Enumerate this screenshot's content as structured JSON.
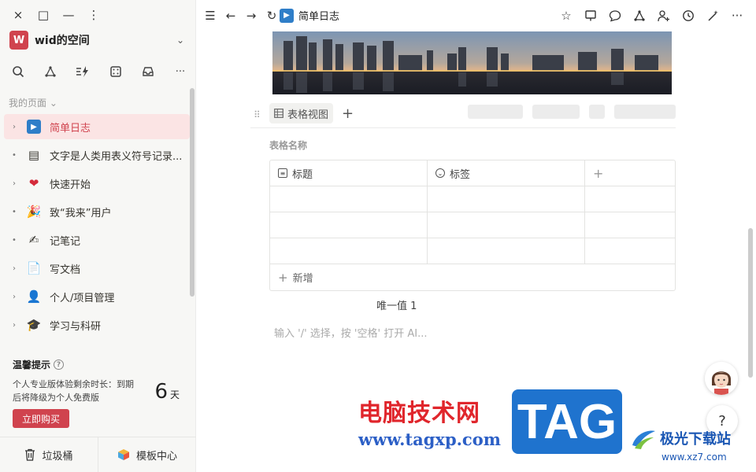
{
  "window": {
    "close": "×",
    "maximize": "□",
    "minimize": "—",
    "more": "⋮"
  },
  "workspace": {
    "avatar_letter": "W",
    "name": "wid的空间",
    "avatar_color": "#d0434e"
  },
  "sidebar": {
    "tools": [
      "search-icon",
      "graph-icon",
      "lightning-icon",
      "dice-icon",
      "inbox-icon",
      "more-icon"
    ],
    "section_label": "我的页面",
    "items": [
      {
        "label": "简单日志",
        "icon": "▶",
        "active": true,
        "expand": "›"
      },
      {
        "label": "文字是人类用表义符号记录...",
        "icon": "▤",
        "active": false,
        "expand": "•"
      },
      {
        "label": "快速开始",
        "icon": "❤",
        "active": false,
        "expand": "›"
      },
      {
        "label": "致“我来”用户",
        "icon": "🎉",
        "active": false,
        "expand": "•"
      },
      {
        "label": "记笔记",
        "icon": "✍",
        "active": false,
        "expand": "•"
      },
      {
        "label": "写文档",
        "icon": "📄",
        "active": false,
        "expand": "›"
      },
      {
        "label": "个人/项目管理",
        "icon": "👤",
        "active": false,
        "expand": "›"
      },
      {
        "label": "学习与科研",
        "icon": "🎓",
        "active": false,
        "expand": "›"
      }
    ],
    "tip": {
      "title": "温馨提示",
      "text": "个人专业版体验剩余时长：到期后将降级为个人免费版",
      "days": "6",
      "days_unit": "天",
      "buy": "立即购买"
    },
    "footer": {
      "trash": "垃圾桶",
      "templates": "模板中心"
    }
  },
  "topbar": {
    "breadcrumb": "简单日志",
    "actions": [
      "star-icon",
      "present-icon",
      "comment-icon",
      "graph-icon",
      "share-user-icon",
      "history-icon",
      "magic-icon",
      "more-icon"
    ]
  },
  "main": {
    "view_tab": "表格视图",
    "table_name": "表格名称",
    "columns": [
      "标题",
      "标签"
    ],
    "add_column": "+",
    "rows": [
      [
        "",
        ""
      ],
      [
        "",
        ""
      ],
      [
        "",
        ""
      ]
    ],
    "add_row": "新增",
    "unique": "唯一值 1",
    "placeholder": "输入 '/' 选择，按 '空格' 打开 AI..."
  },
  "help": "?",
  "watermark": {
    "cn": "电脑技术网",
    "url": "www.tagxp.com",
    "tag": "TAG",
    "jg": "极光下载站",
    "jg_url": "www.xz7.com"
  }
}
